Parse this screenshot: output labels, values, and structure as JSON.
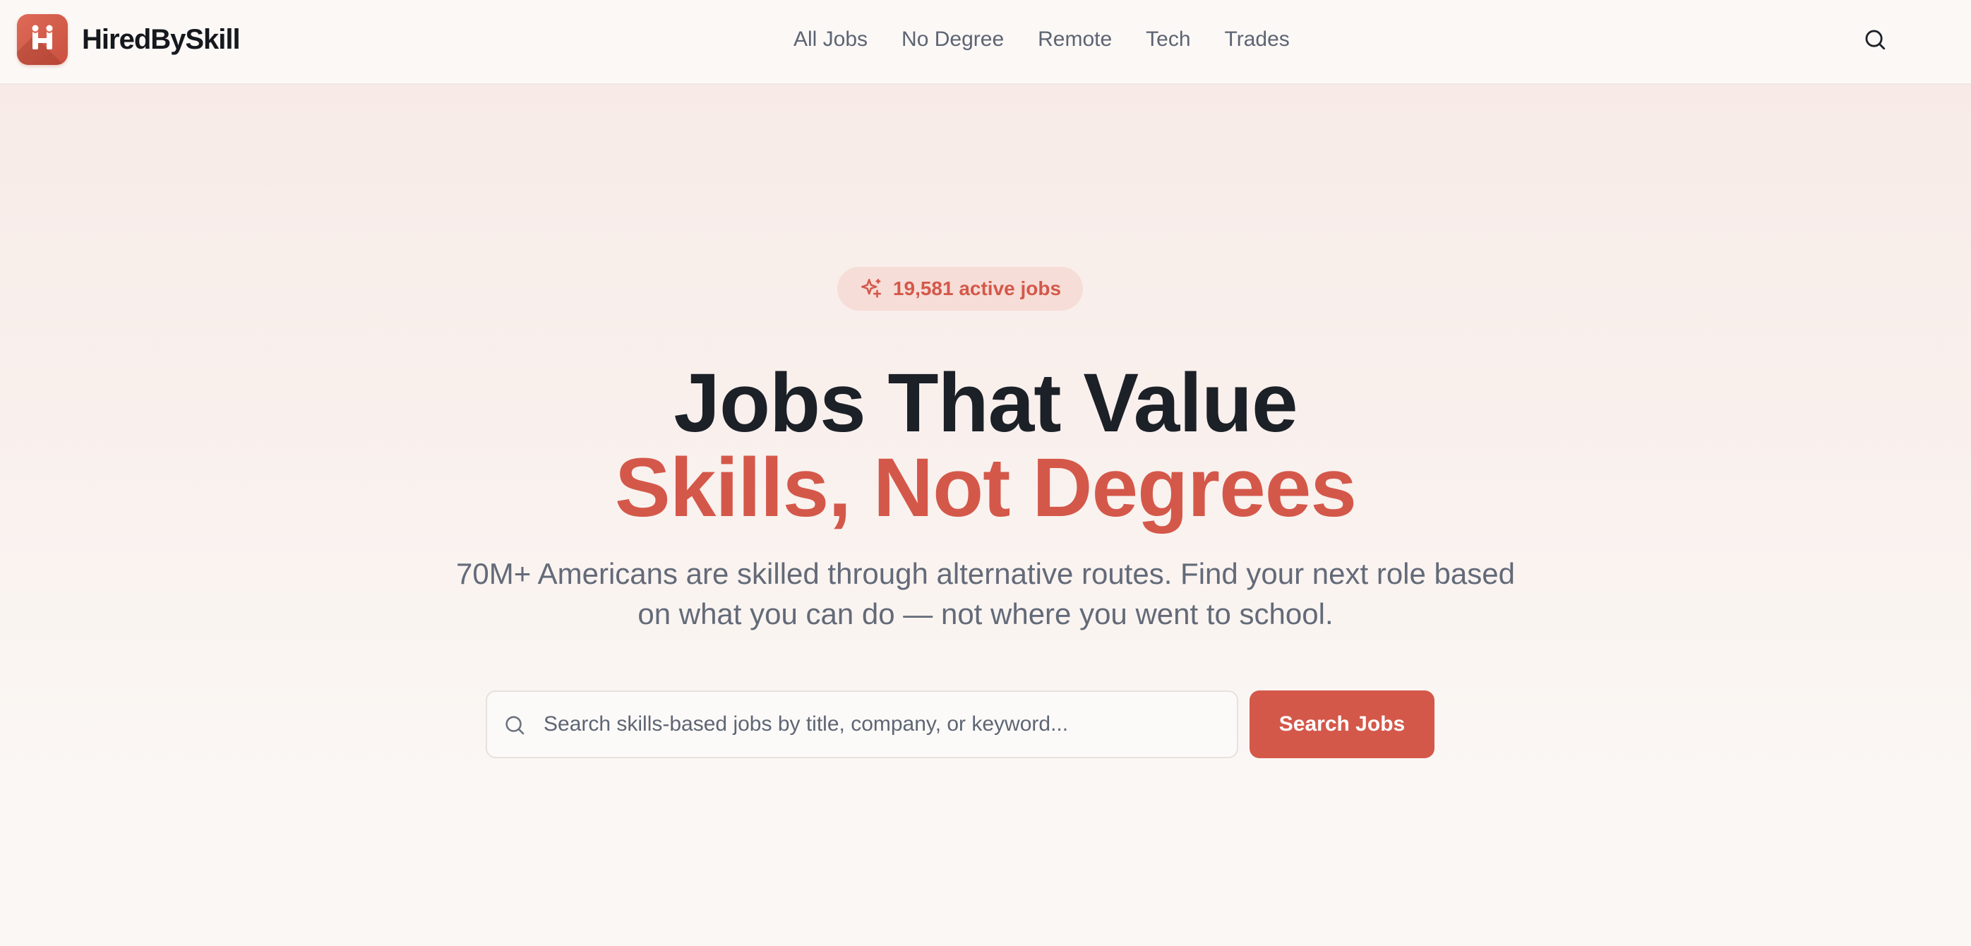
{
  "brand": {
    "name": "HiredBySkill",
    "accent_color": "#d4584a",
    "logo_icon": "h-monogram-logo-icon"
  },
  "nav": {
    "items": [
      {
        "label": "All Jobs"
      },
      {
        "label": "No Degree"
      },
      {
        "label": "Remote"
      },
      {
        "label": "Tech"
      },
      {
        "label": "Trades"
      }
    ],
    "search_icon": "search-icon"
  },
  "hero": {
    "badge": {
      "icon": "sparkles-icon",
      "text": "19,581 active jobs"
    },
    "title_line1": "Jobs That Value",
    "title_line2": "Skills, Not Degrees",
    "subtitle": "70M+ Americans are skilled through alternative routes. Find your next role based on what you can do — not where you went to school.",
    "search": {
      "placeholder": "Search skills-based jobs by title, company, or keyword...",
      "value": "",
      "button_label": "Search Jobs"
    }
  }
}
